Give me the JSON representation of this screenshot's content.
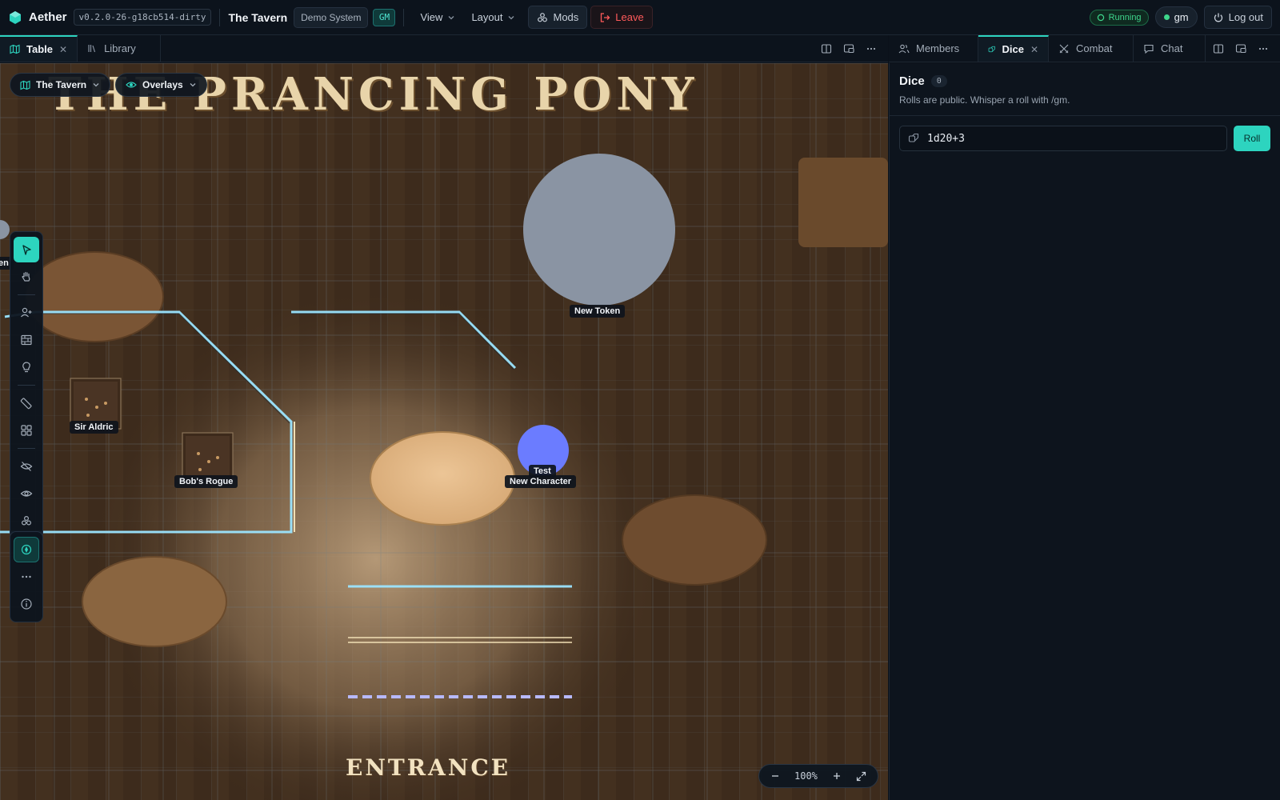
{
  "app": {
    "name": "Aether",
    "version": "v0.2.0-26-g18cb514-dirty",
    "room_title": "The Tavern",
    "system": "Demo System",
    "role_badge": "GM"
  },
  "menus": {
    "view": "View",
    "layout": "Layout"
  },
  "buttons": {
    "mods": "Mods",
    "leave": "Leave",
    "logout": "Log out"
  },
  "status": {
    "running": "Running",
    "user": "gm"
  },
  "left_tabs": [
    {
      "label": "Table",
      "active": true
    },
    {
      "label": "Library",
      "active": false
    }
  ],
  "right_tabs": [
    {
      "label": "Members",
      "active": false
    },
    {
      "label": "Dice",
      "active": true
    },
    {
      "label": "Combat",
      "active": false
    },
    {
      "label": "Chat",
      "active": false
    }
  ],
  "map": {
    "scene_selector": "The Tavern",
    "overlays": "Overlays",
    "title_text": "THE PRANCING PONY",
    "entrance_text": "ENTRANCE",
    "zoom": "100%",
    "tokens": [
      {
        "label": "New Token"
      },
      {
        "label_line1": "Test",
        "label_line2": "New Character"
      },
      {
        "label": "Sir Aldric"
      },
      {
        "label": "Bob's Rogue"
      }
    ],
    "edge_label": "en"
  },
  "dice": {
    "title": "Dice",
    "count": "0",
    "subtitle": "Rolls are public. Whisper a roll with /gm.",
    "input_value": "1d20+3",
    "roll_label": "Roll"
  },
  "colors": {
    "accent": "#2dd4bf",
    "danger": "#ff5a5a",
    "running": "#3ed68c",
    "token_blue": "#6b7cff",
    "token_grey": "#8a94a3"
  }
}
